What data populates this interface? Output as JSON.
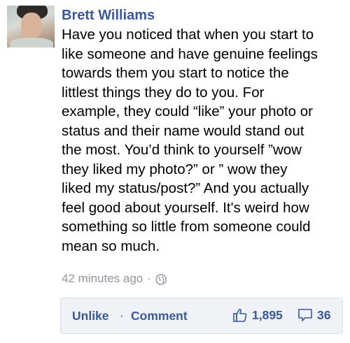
{
  "post": {
    "author": "Brett Williams",
    "message": "Have you noticed that when you start to\nlike someone and have genuine feelings\ntowards them you start to notice the\nlittlest things they do to you. For\nexample, they could “like” your photo or\nstatus and their name would stand out\nthe most. You’d think to yourself ”wow\nthey liked my photo?” or ” wow they\nliked my status/post?” And you actually\nfeel good about yourself. It's weird how\nsomething so little from someone could\nmean so much.",
    "timestamp": "42 minutes ago",
    "meta_separator": "·",
    "privacy_icon": "globe-icon"
  },
  "actions": {
    "unlike_label": "Unlike",
    "separator": "·",
    "comment_label": "Comment",
    "like_icon": "thumbs-up-icon",
    "like_count": "1,895",
    "comment_icon": "speech-bubble-icon",
    "comment_count": "36"
  },
  "colors": {
    "link_blue": "#3b5998",
    "meta_gray": "#90949c",
    "bar_background": "#eff2f7"
  }
}
